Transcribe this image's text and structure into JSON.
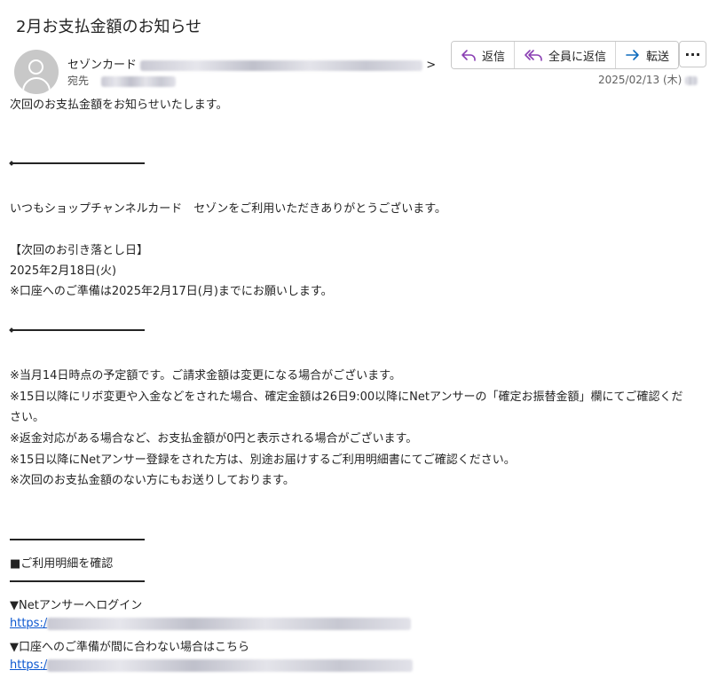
{
  "subject": "2月お支払金額のお知らせ",
  "sender": {
    "name": "セゾンカード",
    "address_end": ">"
  },
  "recipient": {
    "label": "宛先"
  },
  "actions": {
    "reply": "返信",
    "reply_all": "全員に返信",
    "forward": "転送",
    "more": "···"
  },
  "date": "2025/02/13 (木)",
  "body": {
    "intro": "次回のお支払金額をお知らせいたします。",
    "greeting": "いつもショップチャンネルカード　セゾンをご利用いただきありがとうございます。",
    "due_heading": "【次回のお引き落とし日】",
    "due_date": "2025年2月18日(火)",
    "due_note": "※口座へのご準備は2025年2月17日(月)までにお願いします。",
    "notes": [
      "※当月14日時点の予定額です。ご請求金額は変更になる場合がございます。",
      "※15日以降にリボ変更や入金などをされた場合、確定金額は26日9:00以降にNetアンサーの「確定お振替金額」欄にてご確認くだ",
      "さい。",
      "※返金対応がある場合など、お支払金額が0円と表示される場合がございます。",
      "※15日以降にNetアンサー登録をされた方は、別途お届けするご利用明細書にてご確認ください。",
      "※次回のお支払金額のない方にもお送りしております。"
    ],
    "statement_heading": "■ご利用明細を確認",
    "login_label": "▼Netアンサーへログイン",
    "link_prefix": "https:/",
    "account_label": "▼口座へのご準備が間に合わない場合はこちら",
    "link2_prefix": "https:/"
  }
}
